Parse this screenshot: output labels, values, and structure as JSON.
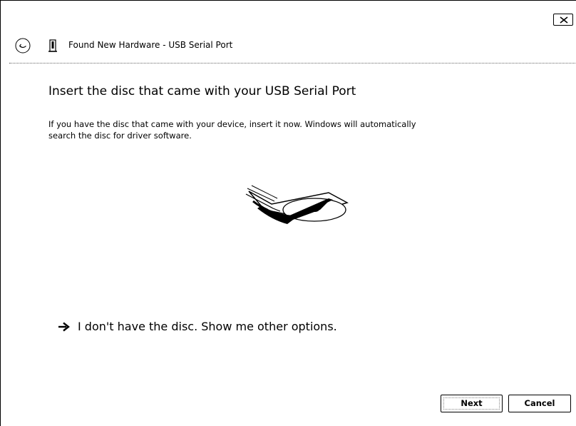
{
  "window": {
    "title": "Found New Hardware - USB Serial Port"
  },
  "icons": {
    "close": "close-icon",
    "back": "back-arrow-icon",
    "usb": "usb-device-icon",
    "link_arrow": "arrow-right-icon",
    "illustration": "disc-drive-illustration"
  },
  "main": {
    "heading": "Insert the disc that came with your USB Serial Port",
    "body_line1": "If you have the disc that came with your device, insert it now.  Windows will automatically",
    "body_line2": "search the disc for driver software.",
    "option_link": "I don't have the disc.  Show me other options."
  },
  "footer": {
    "next_label": "Next",
    "cancel_label": "Cancel"
  }
}
